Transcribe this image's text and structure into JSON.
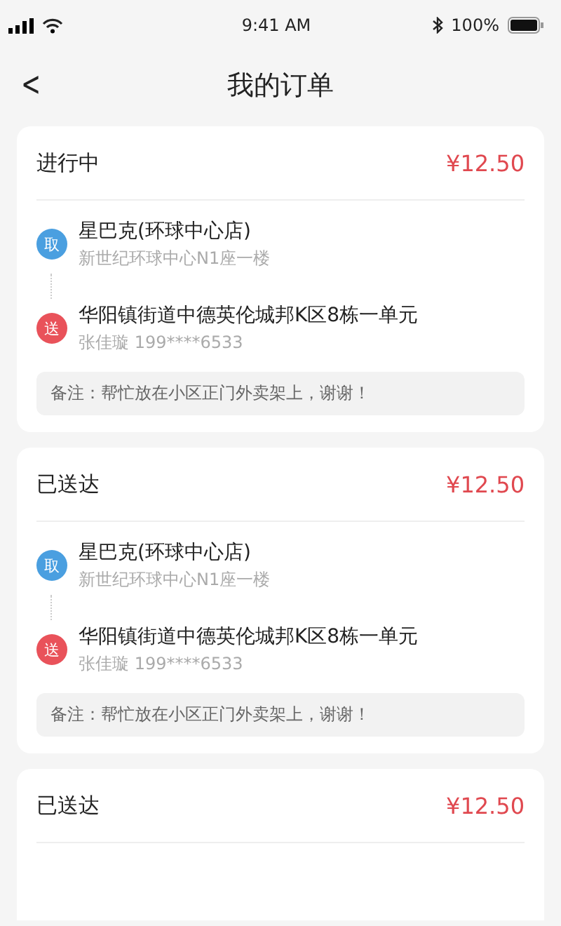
{
  "status_bar": {
    "time": "9:41 AM",
    "battery": "100%"
  },
  "nav": {
    "back": "<",
    "title": "我的订单"
  },
  "orders": [
    {
      "status": "进行中",
      "price": "¥12.50",
      "stops": [
        {
          "badge": "取",
          "color": "#4a9fe0",
          "name": "星巴克(环球中心店)",
          "detail": "新世纪环球中心N1座一楼"
        },
        {
          "badge": "送",
          "color": "#e9525a",
          "name": "华阳镇街道中德英伦城邦K区8栋一单元",
          "detail": "张佳璇 199****6533"
        }
      ],
      "note": "备注：帮忙放在小区正门外卖架上，谢谢！"
    },
    {
      "status": "已送达",
      "price": "¥12.50",
      "stops": [
        {
          "badge": "取",
          "color": "#4a9fe0",
          "name": "星巴克(环球中心店)",
          "detail": "新世纪环球中心N1座一楼"
        },
        {
          "badge": "送",
          "color": "#e9525a",
          "name": "华阳镇街道中德英伦城邦K区8栋一单元",
          "detail": "张佳璇 199****6533"
        }
      ],
      "note": "备注：帮忙放在小区正门外卖架上，谢谢！"
    },
    {
      "status": "已送达",
      "price": "¥12.50"
    }
  ]
}
